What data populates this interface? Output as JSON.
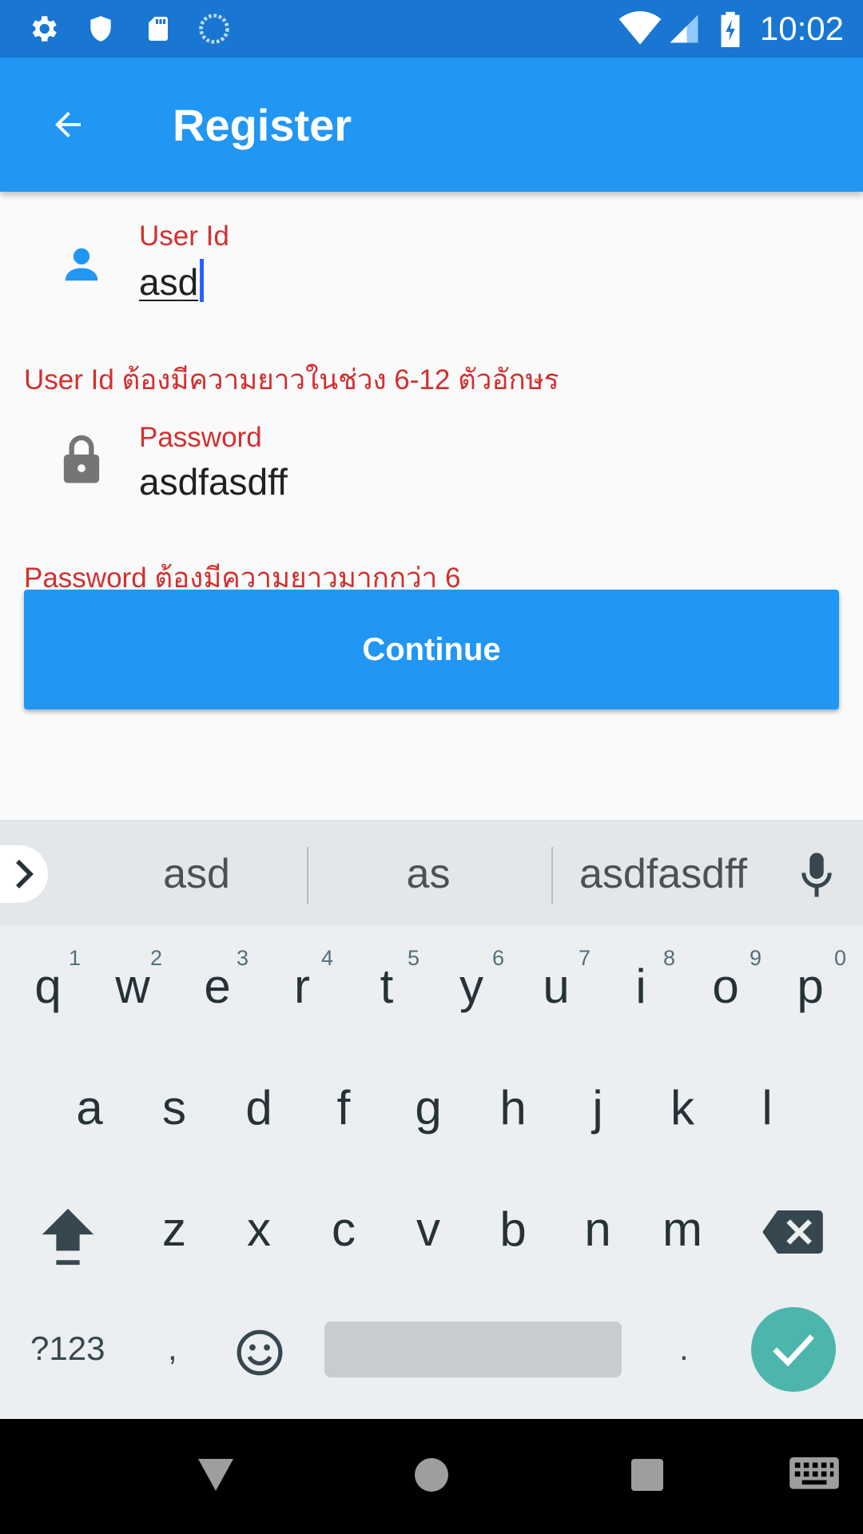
{
  "status_bar": {
    "time": "10:02",
    "left_icons": [
      "gear-icon",
      "shield-icon",
      "sd-card-icon",
      "sync-icon"
    ],
    "right_icons": [
      "wifi-icon",
      "signal-icon",
      "battery-charging-icon"
    ]
  },
  "app_bar": {
    "title": "Register",
    "back_icon": "arrow-back-icon",
    "color": "#2196f3"
  },
  "form": {
    "user_id": {
      "label": "User Id",
      "value": "asd",
      "icon": "person-icon",
      "error": "User Id ต้องมีความยาวในช่วง 6-12 ตัวอักษร"
    },
    "password": {
      "label": "Password",
      "value": "asdfasdff",
      "icon": "lock-icon",
      "error": "Password ต้องมีความยาวมากกว่า 6"
    },
    "continue_label": "Continue",
    "error_color": "#d32f2f"
  },
  "keyboard": {
    "suggestions": [
      "asd",
      "as",
      "asdfasdff"
    ],
    "row1": [
      "q",
      "w",
      "e",
      "r",
      "t",
      "y",
      "u",
      "i",
      "o",
      "p"
    ],
    "row1_hints": [
      "1",
      "2",
      "3",
      "4",
      "5",
      "6",
      "7",
      "8",
      "9",
      "0"
    ],
    "row2": [
      "a",
      "s",
      "d",
      "f",
      "g",
      "h",
      "j",
      "k",
      "l"
    ],
    "row3": [
      "z",
      "x",
      "c",
      "v",
      "b",
      "n",
      "m"
    ],
    "symbols_label": "?123",
    "comma": ",",
    "period": ".",
    "enter_color": "#4db6ac"
  }
}
